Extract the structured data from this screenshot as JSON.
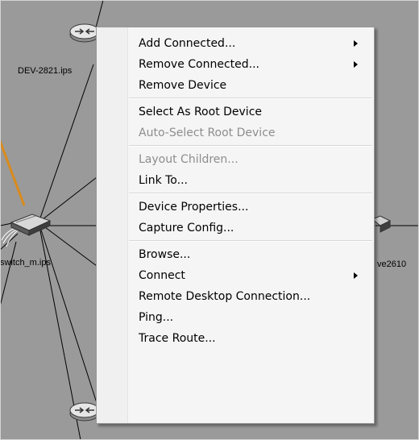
{
  "canvas": {
    "background": "#9a9a9a",
    "node_labels": [
      "DEV-2821.ips",
      "switch_m.ips",
      "ve2610"
    ],
    "link_colors": {
      "normal": "#000000",
      "highlight": "#d98a1c"
    },
    "icons": [
      "router-icon",
      "switch-icon"
    ]
  },
  "context_menu": {
    "groups": [
      [
        {
          "label": "Add Connected...",
          "submenu": true,
          "enabled": true
        },
        {
          "label": "Remove Connected...",
          "submenu": true,
          "enabled": true
        },
        {
          "label": "Remove Device",
          "submenu": false,
          "enabled": true
        }
      ],
      [
        {
          "label": "Select As Root Device",
          "submenu": false,
          "enabled": true
        },
        {
          "label": "Auto-Select Root Device",
          "submenu": false,
          "enabled": false
        }
      ],
      [
        {
          "label": "Layout Children...",
          "submenu": false,
          "enabled": false
        },
        {
          "label": "Link To...",
          "submenu": false,
          "enabled": true
        }
      ],
      [
        {
          "label": "Device Properties...",
          "submenu": false,
          "enabled": true
        },
        {
          "label": "Capture Config...",
          "submenu": false,
          "enabled": true
        }
      ],
      [
        {
          "label": "Browse...",
          "submenu": false,
          "enabled": true
        },
        {
          "label": "Connect",
          "submenu": true,
          "enabled": true
        },
        {
          "label": "Remote Desktop Connection...",
          "submenu": false,
          "enabled": true
        },
        {
          "label": "Ping...",
          "submenu": false,
          "enabled": true
        },
        {
          "label": "Trace Route...",
          "submenu": false,
          "enabled": true
        }
      ]
    ],
    "disabled_color": "#8d8d8d"
  }
}
